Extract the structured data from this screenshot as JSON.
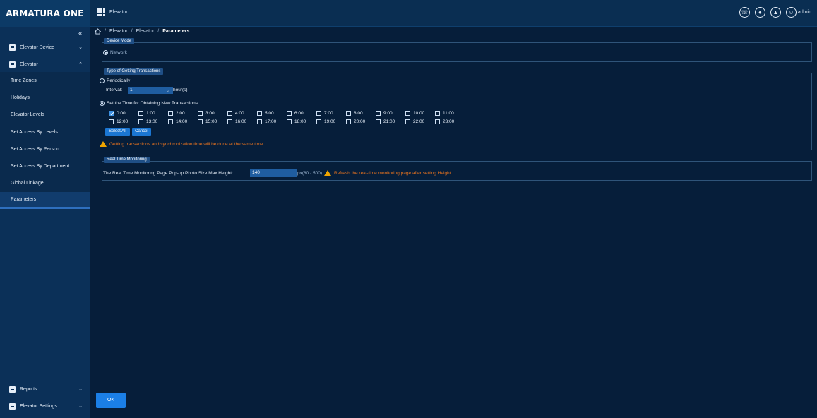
{
  "header": {
    "brand": "ARMATURA ONE",
    "module": "Elevator",
    "user": "admin"
  },
  "sidebar": {
    "collapse_icon": "«",
    "groups": [
      {
        "label": "Elevator Device",
        "icon": "elevator-device-icon"
      },
      {
        "label": "Elevator",
        "icon": "elevator-icon"
      }
    ],
    "items": [
      {
        "label": "Time Zones"
      },
      {
        "label": "Holidays"
      },
      {
        "label": "Elevator Levels"
      },
      {
        "label": "Set Access By Levels"
      },
      {
        "label": "Set Access By Person"
      },
      {
        "label": "Set Access By Department"
      },
      {
        "label": "Global Linkage"
      },
      {
        "label": "Parameters"
      }
    ],
    "bottom": [
      {
        "label": "Reports",
        "icon": "reports-icon"
      },
      {
        "label": "Elevator Settings",
        "icon": "elevator-settings-icon"
      }
    ]
  },
  "breadcrumb": [
    "Elevator",
    "Elevator",
    "Parameters"
  ],
  "device_mode": {
    "title": "Device Mode",
    "option": "Network"
  },
  "transactions": {
    "title": "Type of Getting Transactions",
    "periodically": "Periodically",
    "interval_label": "Interval:",
    "interval_value": "1",
    "interval_unit": "hour(s)",
    "set_time": "Set the Time for Obtaining New Transactions",
    "row1": [
      "0:00",
      "1:00",
      "2:00",
      "3:00",
      "4:00",
      "5:00",
      "6:00",
      "7:00",
      "8:00",
      "9:00",
      "10:00",
      "11:00"
    ],
    "row2": [
      "12:00",
      "13:00",
      "14:00",
      "15:00",
      "16:00",
      "17:00",
      "18:00",
      "19:00",
      "20:00",
      "21:00",
      "22:00",
      "23:00"
    ],
    "select_all": "Select All",
    "cancel": "Cancel",
    "warning": "Getting transactions and synchronization time will be done at the same time."
  },
  "realtime": {
    "title": "Real Time Monitoring",
    "label": "The Real Time Monitoring Page Pop-up Photo Size   Max Height:",
    "value": "140",
    "unit": "px(80 - 500)",
    "warning": "Refresh the real-time monitoring page after setting Height."
  },
  "footer": {
    "ok": "OK"
  },
  "colors": {
    "accent": "#1b7fe6",
    "warning": "#e8731f"
  }
}
